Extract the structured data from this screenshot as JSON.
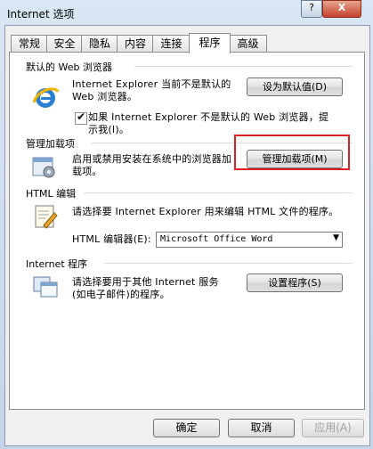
{
  "window": {
    "title": "Internet 选项",
    "help": "?",
    "close": "X"
  },
  "tabs": [
    {
      "label": "常规"
    },
    {
      "label": "安全"
    },
    {
      "label": "隐私"
    },
    {
      "label": "内容"
    },
    {
      "label": "连接"
    },
    {
      "label": "程序"
    },
    {
      "label": "高级"
    }
  ],
  "default_browser": {
    "title": "默认的 Web 浏览器",
    "line1": "Internet Explorer 当前不是默认的",
    "line2": "Web 浏览器。",
    "set_default_button": "设为默认值(D)",
    "checkbox_checked": true,
    "checkbox_line1": "如果 Internet Explorer 不是默认的 Web 浏览器，提",
    "checkbox_line2": "示我(I)。"
  },
  "addons": {
    "title": "管理加载项",
    "line1": "启用或禁用安装在系统中的浏览器加",
    "line2": "载项。",
    "manage_button": "管理加载项(M)"
  },
  "html_editing": {
    "title": "HTML 编辑",
    "desc": "请选择要 Internet Explorer 用来编辑 HTML 文件的程序。",
    "editor_label": "HTML 编辑器(E):",
    "editor_value": "Microsoft Office Word"
  },
  "internet_programs": {
    "title": "Internet 程序",
    "line1": "请选择要用于其他 Internet 服务",
    "line2": "(如电子邮件)的程序。",
    "set_programs_button": "设置程序(S)"
  },
  "footer": {
    "ok": "确定",
    "cancel": "取消",
    "apply": "应用(A)"
  },
  "colors": {
    "highlight": "#e02020"
  }
}
